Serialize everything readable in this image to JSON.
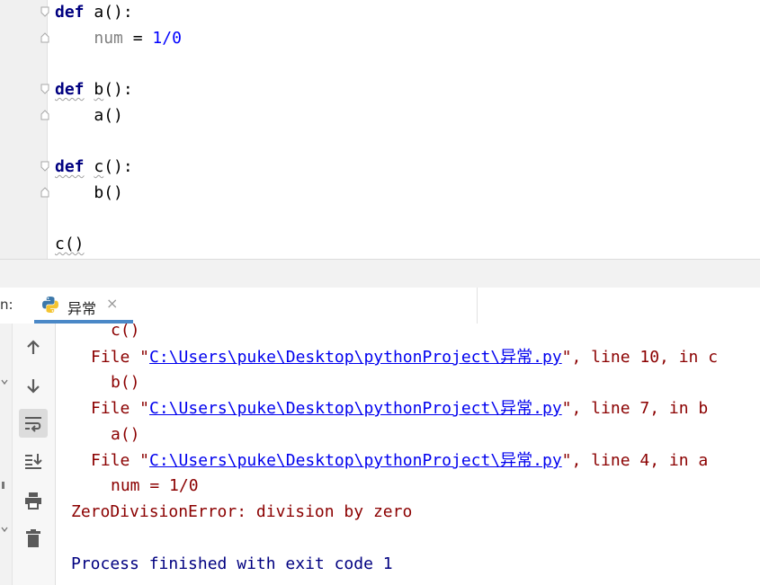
{
  "editor": {
    "lines": [
      {
        "kw": "def",
        "rest": " a():"
      },
      {
        "indent": "    ",
        "var": "num",
        "op": " = ",
        "num": "1/0"
      },
      {
        "kw": "def",
        "name": "b",
        "rest": "():"
      },
      {
        "indent": "    ",
        "call": "a()"
      },
      {
        "kw": "def",
        "name": "c",
        "rest": "():"
      },
      {
        "indent": "    ",
        "call": "b()"
      },
      {
        "call": "c()"
      }
    ]
  },
  "run_panel": {
    "label": "n:",
    "tab": {
      "label": "异常",
      "close": "×",
      "icon": "python-icon"
    }
  },
  "toolbar": {
    "icons": [
      "up-arrow-icon",
      "down-arrow-icon",
      "soft-wrap-icon",
      "scroll-to-end-icon",
      "print-icon",
      "trash-icon"
    ]
  },
  "console": {
    "top_partial": "c()",
    "frames": [
      {
        "prefix": "File \"",
        "path": "C:\\Users\\puke\\Desktop\\pythonProject\\异常.py",
        "suffix": "\", line 10, in c",
        "code": "b()"
      },
      {
        "prefix": "File \"",
        "path": "C:\\Users\\puke\\Desktop\\pythonProject\\异常.py",
        "suffix": "\", line 7, in b",
        "code": "a()"
      },
      {
        "prefix": "File \"",
        "path": "C:\\Users\\puke\\Desktop\\pythonProject\\异常.py",
        "suffix": "\", line 4, in a",
        "code": "num = 1/0"
      }
    ],
    "error": "ZeroDivisionError: division by zero",
    "process": "Process finished with exit code 1"
  },
  "colors": {
    "keyword": "#000080",
    "number": "#0000ff",
    "error_text": "#8b0000",
    "link": "#0000ee",
    "tab_underline": "#4a88c7"
  }
}
